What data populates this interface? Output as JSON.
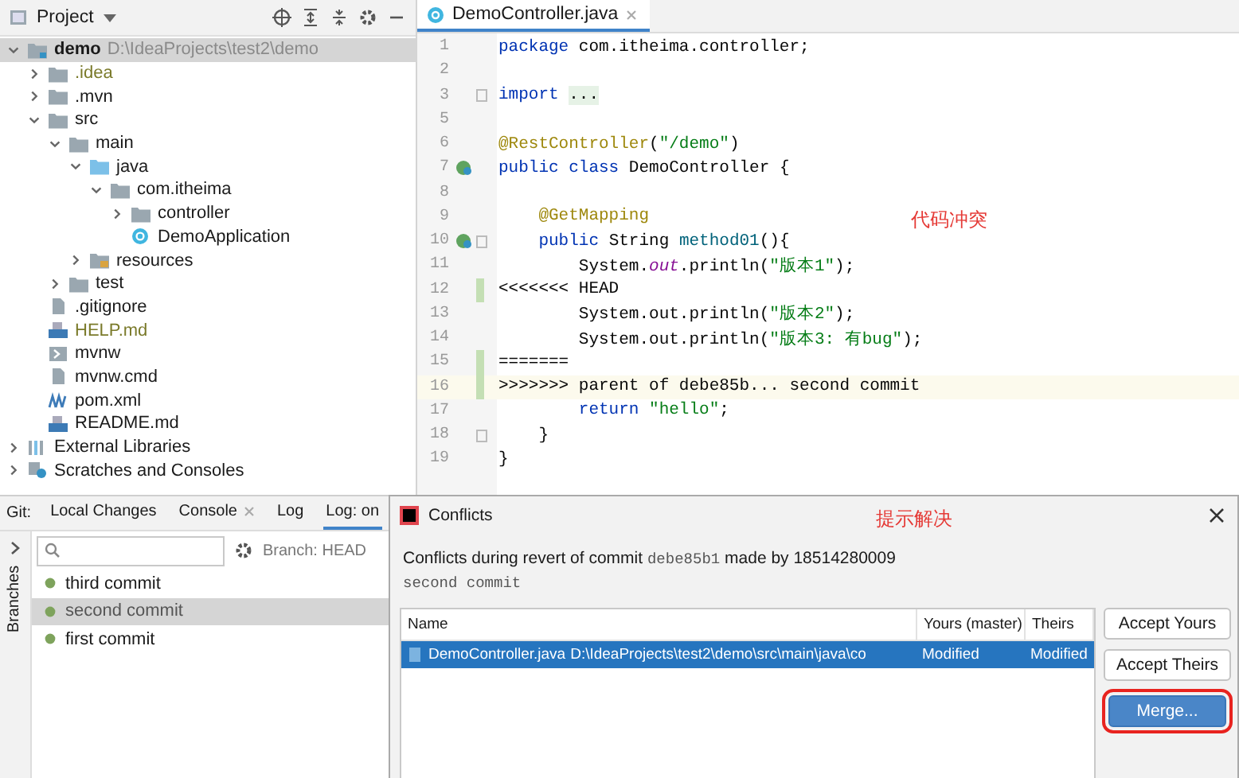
{
  "project_panel": {
    "title": "Project",
    "tree": [
      {
        "name": "demo",
        "path": "D:\\IdeaProjects\\test2\\demo",
        "kind": "module",
        "expanded": true,
        "selected": true,
        "children": [
          {
            "name": ".idea",
            "kind": "folder",
            "expanded": false,
            "selected": false,
            "color": "#7a7a2a"
          },
          {
            "name": ".mvn",
            "kind": "folder",
            "expanded": false,
            "selected": false
          },
          {
            "name": "src",
            "kind": "folder",
            "expanded": true,
            "selected": false,
            "children": [
              {
                "name": "main",
                "kind": "folder",
                "expanded": true,
                "selected": false,
                "children": [
                  {
                    "name": "java",
                    "kind": "source",
                    "expanded": true,
                    "selected": false,
                    "children": [
                      {
                        "name": "com.itheima",
                        "kind": "package",
                        "expanded": true,
                        "selected": false,
                        "children": [
                          {
                            "name": "controller",
                            "kind": "package",
                            "expanded": false,
                            "selected": false
                          },
                          {
                            "name": "DemoApplication",
                            "kind": "class",
                            "selected": false
                          }
                        ]
                      }
                    ]
                  },
                  {
                    "name": "resources",
                    "kind": "resources",
                    "expanded": false,
                    "selected": false
                  }
                ]
              },
              {
                "name": "test",
                "kind": "folder",
                "expanded": false,
                "selected": false
              }
            ]
          },
          {
            "name": ".gitignore",
            "kind": "file",
            "selected": false
          },
          {
            "name": "HELP.md",
            "kind": "markdown",
            "selected": false,
            "color": "#7a7a2a"
          },
          {
            "name": "mvnw",
            "kind": "script",
            "selected": false
          },
          {
            "name": "mvnw.cmd",
            "kind": "file",
            "selected": false
          },
          {
            "name": "pom.xml",
            "kind": "maven",
            "selected": false
          },
          {
            "name": "README.md",
            "kind": "markdown",
            "selected": false
          }
        ]
      },
      {
        "name": "External Libraries",
        "kind": "libraries",
        "expanded": false,
        "selected": false
      },
      {
        "name": "Scratches and Consoles",
        "kind": "scratches",
        "expanded": false,
        "selected": false
      }
    ]
  },
  "editor": {
    "tab": {
      "title": "DemoController.java",
      "selected": true
    },
    "note": "代码冲突",
    "lines": [
      {
        "number": "1",
        "tokens": [
          {
            "kind": "keyword",
            "text": "package"
          },
          {
            "kind": "plain",
            "text": " com.itheima.controller;"
          }
        ]
      },
      {
        "number": "2"
      },
      {
        "number": "3",
        "foldable": true,
        "tokens": [
          {
            "kind": "keyword",
            "text": "import"
          },
          {
            "kind": "folded",
            "text": "..."
          }
        ]
      },
      {
        "number": "5"
      },
      {
        "number": "6",
        "tokens": [
          {
            "kind": "annotation",
            "text": "@RestController"
          },
          {
            "kind": "plain",
            "text": "("
          },
          {
            "kind": "string",
            "text": "\"/demo\""
          },
          {
            "kind": "plain",
            "text": ")"
          }
        ]
      },
      {
        "number": "7",
        "gutter_icon": true,
        "tokens": [
          {
            "kind": "keyword",
            "text": "public class"
          },
          {
            "kind": "plain",
            "text": " DemoController {"
          }
        ]
      },
      {
        "number": "8"
      },
      {
        "number": "9",
        "tokens": [
          {
            "kind": "annotation",
            "text": "    @GetMapping"
          }
        ]
      },
      {
        "number": "10",
        "gutter_icon": true,
        "foldable": true,
        "tokens": [
          {
            "kind": "keyword",
            "text": "    public"
          },
          {
            "kind": "plain",
            "text": " String "
          },
          {
            "kind": "method",
            "text": "method01"
          },
          {
            "kind": "plain",
            "text": "(){"
          }
        ]
      },
      {
        "number": "11",
        "tokens": [
          {
            "kind": "plain",
            "text": "        System."
          },
          {
            "kind": "field",
            "text": "out"
          },
          {
            "kind": "plain",
            "text": ".println("
          },
          {
            "kind": "string",
            "text": "\"版本1\""
          },
          {
            "kind": "plain",
            "text": ");"
          }
        ]
      },
      {
        "number": "12",
        "changed": true,
        "tokens": [
          {
            "kind": "plain",
            "text": "<<<<<<< HEAD"
          }
        ]
      },
      {
        "number": "13",
        "tokens": [
          {
            "kind": "plain",
            "text": "        System.out.println("
          },
          {
            "kind": "string",
            "text": "\"版本2\""
          },
          {
            "kind": "plain",
            "text": ");"
          }
        ]
      },
      {
        "number": "14",
        "tokens": [
          {
            "kind": "plain",
            "text": "        System.out.println("
          },
          {
            "kind": "string",
            "text": "\"版本3: 有bug\""
          },
          {
            "kind": "plain",
            "text": ");"
          }
        ]
      },
      {
        "number": "15",
        "changed": true,
        "tokens": [
          {
            "kind": "plain",
            "text": "======="
          }
        ]
      },
      {
        "number": "16",
        "changed": true,
        "current": true,
        "tokens": [
          {
            "kind": "plain",
            "text": ">>>>>>> parent of debe85b... second commit"
          }
        ]
      },
      {
        "number": "17",
        "tokens": [
          {
            "kind": "keyword",
            "text": "        return"
          },
          {
            "kind": "string",
            "text": " \"hello\""
          },
          {
            "kind": "plain",
            "text": ";"
          }
        ]
      },
      {
        "number": "18",
        "foldable": true,
        "tokens": [
          {
            "kind": "plain",
            "text": "    }"
          }
        ]
      },
      {
        "number": "19",
        "tokens": [
          {
            "kind": "plain",
            "text": "}"
          }
        ]
      }
    ]
  },
  "git_panel": {
    "label": "Git:",
    "tabs": [
      {
        "label": "Local Changes",
        "selected": false,
        "closable": false
      },
      {
        "label": "Console",
        "selected": false,
        "closable": true
      },
      {
        "label": "Log",
        "selected": false,
        "closable": false
      },
      {
        "label": "Log: on",
        "selected": true,
        "closable": false
      }
    ],
    "sidebar_label": "Branches",
    "branch_filter": "Branch: HEAD",
    "commits": [
      {
        "message": "third commit",
        "selected": false
      },
      {
        "message": "second commit",
        "selected": true
      },
      {
        "message": "first commit",
        "selected": false
      }
    ]
  },
  "dialog": {
    "title": "Conflicts",
    "note": "提示解决",
    "message": {
      "prefix": "Conflicts during revert of commit",
      "hash": "debe85b1",
      "suffix": "made by 18514280009"
    },
    "commit_message": "second commit",
    "columns": [
      "Name",
      "Yours (master)",
      "Theirs"
    ],
    "rows": [
      {
        "file": "DemoController.java",
        "path": "D:\\IdeaProjects\\test2\\demo\\src\\main\\java\\co",
        "yours": "Modified",
        "theirs": "Modified",
        "selected": true
      }
    ],
    "buttons": [
      {
        "label": "Accept Yours",
        "primary": false,
        "highlighted": false
      },
      {
        "label": "Accept Theirs",
        "primary": false,
        "highlighted": false
      },
      {
        "label": "Merge...",
        "primary": true,
        "highlighted": true
      }
    ]
  }
}
